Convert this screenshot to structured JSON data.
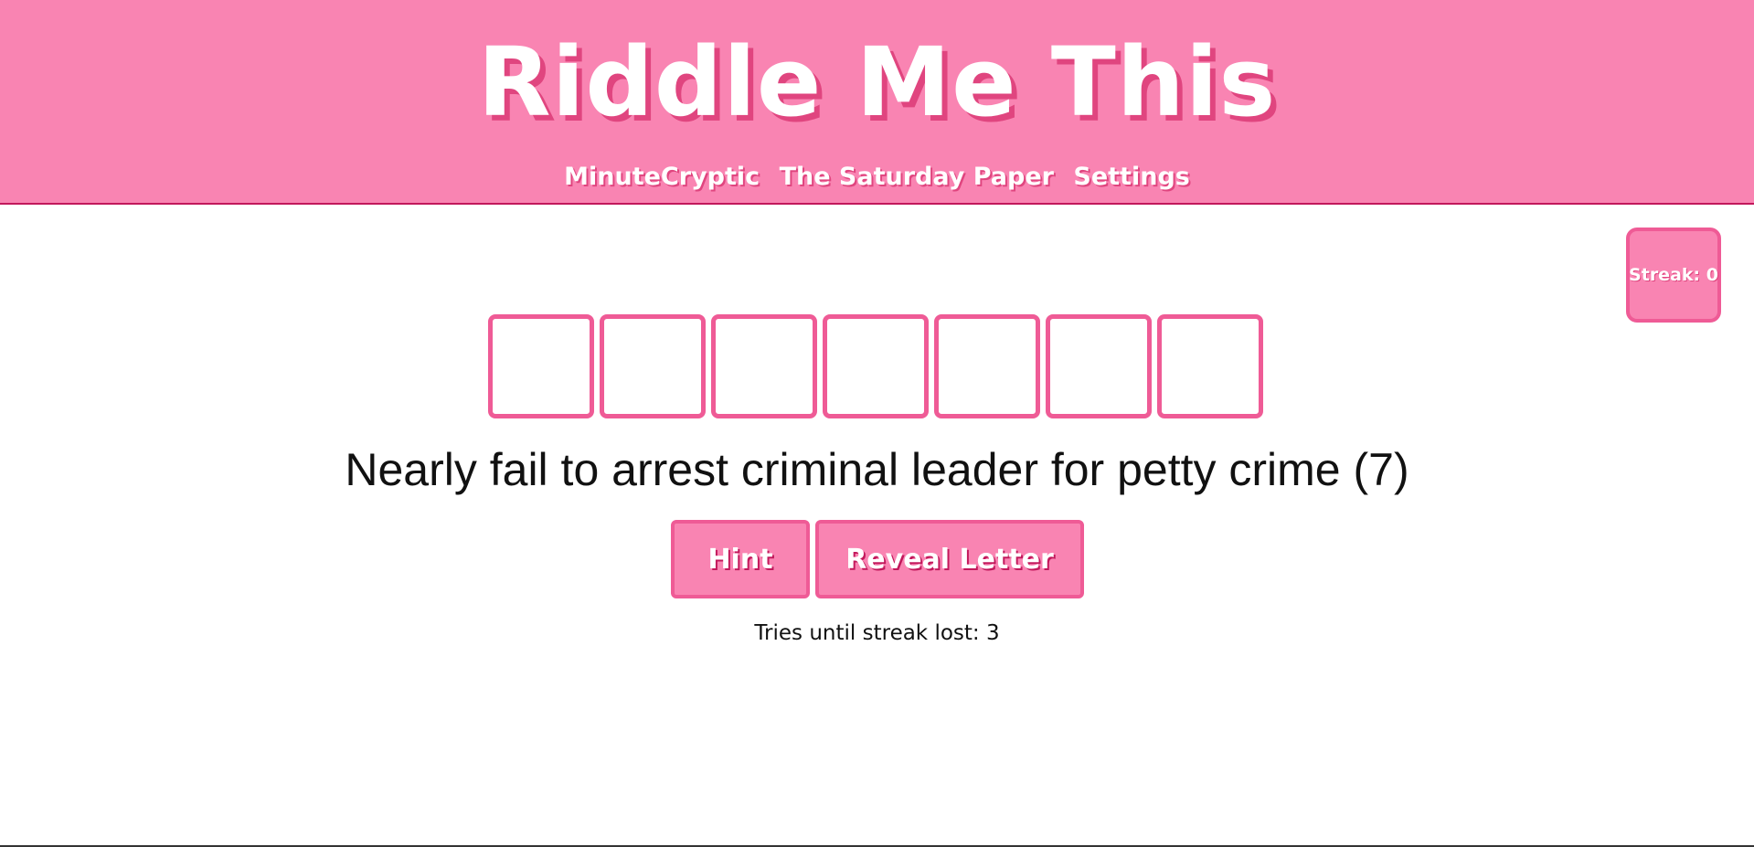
{
  "header": {
    "title": "Riddle Me This",
    "nav": [
      {
        "label": "MinuteCryptic"
      },
      {
        "label": "The Saturday Paper"
      },
      {
        "label": "Settings"
      }
    ]
  },
  "streak": {
    "label": "Streak: 0"
  },
  "puzzle": {
    "answer_length": 7,
    "letters": [
      "",
      "",
      "",
      "",
      "",
      "",
      ""
    ],
    "clue": "Nearly fail to arrest criminal leader for petty crime (7)"
  },
  "actions": {
    "hint_label": "Hint",
    "reveal_label": "Reveal Letter"
  },
  "status": {
    "tries_text": "Tries until streak lost: 3"
  },
  "colors": {
    "header_bg": "#f984b2",
    "accent": "#ef5b96",
    "shadow": "#e0457f"
  }
}
